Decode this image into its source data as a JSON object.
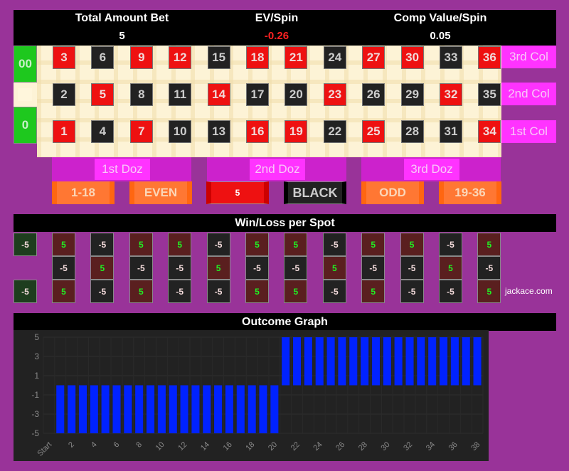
{
  "header": {
    "total_bet_label": "Total Amount Bet",
    "total_bet_value": "5",
    "ev_label": "EV/Spin",
    "ev_value": "-0.26",
    "comp_label": "Comp Value/Spin",
    "comp_value": "0.05"
  },
  "board": {
    "zeros": [
      "00",
      "0"
    ],
    "rows": [
      [
        {
          "n": "3",
          "c": "red"
        },
        {
          "n": "6",
          "c": "black"
        },
        {
          "n": "9",
          "c": "red"
        },
        {
          "n": "12",
          "c": "red"
        },
        {
          "n": "15",
          "c": "black"
        },
        {
          "n": "18",
          "c": "red"
        },
        {
          "n": "21",
          "c": "red"
        },
        {
          "n": "24",
          "c": "black"
        },
        {
          "n": "27",
          "c": "red"
        },
        {
          "n": "30",
          "c": "red"
        },
        {
          "n": "33",
          "c": "black"
        },
        {
          "n": "36",
          "c": "red"
        }
      ],
      [
        {
          "n": "2",
          "c": "black"
        },
        {
          "n": "5",
          "c": "red"
        },
        {
          "n": "8",
          "c": "black"
        },
        {
          "n": "11",
          "c": "black"
        },
        {
          "n": "14",
          "c": "red"
        },
        {
          "n": "17",
          "c": "black"
        },
        {
          "n": "20",
          "c": "black"
        },
        {
          "n": "23",
          "c": "red"
        },
        {
          "n": "26",
          "c": "black"
        },
        {
          "n": "29",
          "c": "black"
        },
        {
          "n": "32",
          "c": "red"
        },
        {
          "n": "35",
          "c": "black"
        }
      ],
      [
        {
          "n": "1",
          "c": "red"
        },
        {
          "n": "4",
          "c": "black"
        },
        {
          "n": "7",
          "c": "red"
        },
        {
          "n": "10",
          "c": "black"
        },
        {
          "n": "13",
          "c": "black"
        },
        {
          "n": "16",
          "c": "red"
        },
        {
          "n": "19",
          "c": "red"
        },
        {
          "n": "22",
          "c": "black"
        },
        {
          "n": "25",
          "c": "red"
        },
        {
          "n": "28",
          "c": "black"
        },
        {
          "n": "31",
          "c": "black"
        },
        {
          "n": "34",
          "c": "red"
        }
      ]
    ],
    "columns": [
      "3rd Col",
      "2nd Col",
      "1st Col"
    ],
    "dozens": [
      "1st Doz",
      "2nd Doz",
      "3rd Doz"
    ],
    "even_money": [
      "1-18",
      "EVEN",
      "RED",
      "BLACK",
      "ODD",
      "19-36"
    ],
    "red_bet_chip": "5"
  },
  "winloss": {
    "title": "Win/Loss per Spot",
    "zeros": [
      "-5",
      "-5"
    ],
    "rows": [
      [
        "5",
        "-5",
        "5",
        "5",
        "-5",
        "5",
        "5",
        "-5",
        "5",
        "5",
        "-5",
        "5"
      ],
      [
        "-5",
        "5",
        "-5",
        "-5",
        "5",
        "-5",
        "-5",
        "5",
        "-5",
        "-5",
        "5",
        "-5"
      ],
      [
        "5",
        "-5",
        "5",
        "-5",
        "-5",
        "5",
        "5",
        "-5",
        "5",
        "-5",
        "-5",
        "5"
      ]
    ],
    "credit": "jackace.com"
  },
  "graph": {
    "title": "Outcome Graph"
  },
  "chart_data": {
    "type": "bar",
    "title": "Outcome Graph",
    "xlabel": "",
    "ylabel": "",
    "categories": [
      "Start",
      "1",
      "2",
      "3",
      "4",
      "5",
      "6",
      "7",
      "8",
      "9",
      "10",
      "11",
      "12",
      "13",
      "14",
      "15",
      "16",
      "17",
      "18",
      "19",
      "20",
      "21",
      "22",
      "23",
      "24",
      "25",
      "26",
      "27",
      "28",
      "29",
      "30",
      "31",
      "32",
      "33",
      "34",
      "35",
      "36",
      "37",
      "38"
    ],
    "values": [
      0,
      -5,
      -5,
      -5,
      -5,
      -5,
      -5,
      -5,
      -5,
      -5,
      -5,
      -5,
      -5,
      -5,
      -5,
      -5,
      -5,
      -5,
      -5,
      -5,
      -5,
      5,
      5,
      5,
      5,
      5,
      5,
      5,
      5,
      5,
      5,
      5,
      5,
      5,
      5,
      5,
      5,
      5,
      5
    ],
    "xtick_labels": [
      "Start",
      "2",
      "4",
      "6",
      "8",
      "10",
      "12",
      "14",
      "16",
      "18",
      "20",
      "22",
      "24",
      "26",
      "28",
      "30",
      "32",
      "34",
      "36",
      "38"
    ],
    "ytick_labels": [
      "5",
      "3",
      "1",
      "-1",
      "-3",
      "-5"
    ],
    "ylim": [
      -5,
      5
    ],
    "grid": true,
    "bar_color": "#0022ff"
  }
}
